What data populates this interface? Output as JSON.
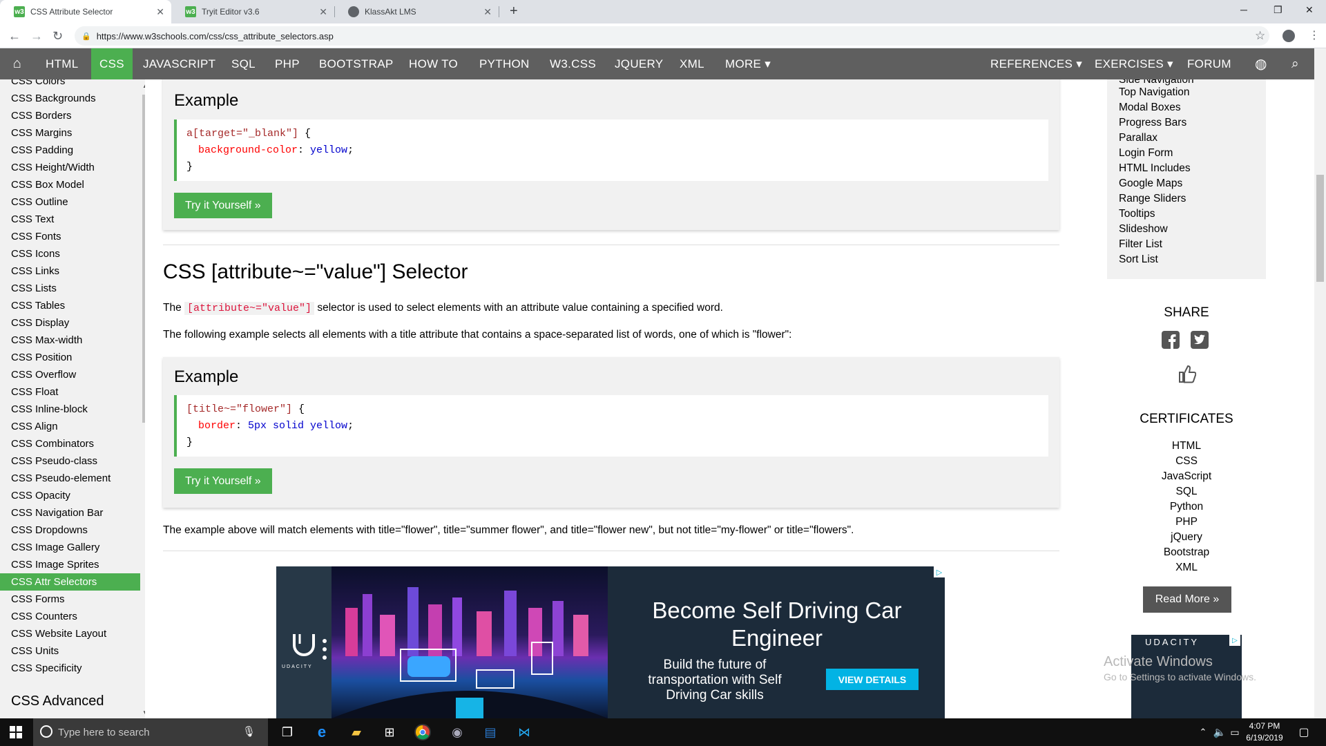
{
  "browser": {
    "tabs": [
      {
        "title": "CSS Attribute Selector",
        "active": true
      },
      {
        "title": "Tryit Editor v3.6",
        "active": false
      },
      {
        "title": "KlassAkt LMS",
        "active": false
      }
    ],
    "url": "https://www.w3schools.com/css/css_attribute_selectors.asp"
  },
  "topnav": {
    "items": [
      "HTML",
      "CSS",
      "JAVASCRIPT",
      "SQL",
      "PHP",
      "BOOTSTRAP",
      "HOW TO",
      "PYTHON",
      "W3.CSS",
      "JQUERY",
      "XML",
      "MORE ▾"
    ],
    "active": "CSS",
    "right_items": [
      "REFERENCES ▾",
      "EXERCISES ▾",
      "FORUM"
    ]
  },
  "sidebar": {
    "items": [
      "CSS Colors",
      "CSS Backgrounds",
      "CSS Borders",
      "CSS Margins",
      "CSS Padding",
      "CSS Height/Width",
      "CSS Box Model",
      "CSS Outline",
      "CSS Text",
      "CSS Fonts",
      "CSS Icons",
      "CSS Links",
      "CSS Lists",
      "CSS Tables",
      "CSS Display",
      "CSS Max-width",
      "CSS Position",
      "CSS Overflow",
      "CSS Float",
      "CSS Inline-block",
      "CSS Align",
      "CSS Combinators",
      "CSS Pseudo-class",
      "CSS Pseudo-element",
      "CSS Opacity",
      "CSS Navigation Bar",
      "CSS Dropdowns",
      "CSS Image Gallery",
      "CSS Image Sprites",
      "CSS Attr Selectors",
      "CSS Forms",
      "CSS Counters",
      "CSS Website Layout",
      "CSS Units",
      "CSS Specificity"
    ],
    "active": "CSS Attr Selectors",
    "advanced_heading": "CSS Advanced"
  },
  "main": {
    "example1": {
      "heading": "Example",
      "code_selector": "a[target=\"_blank\"]",
      "code_open": " {",
      "code_prop": "background-color",
      "code_colon": ": ",
      "code_value": "yellow",
      "code_semi": ";",
      "code_close": "}",
      "button": "Try it Yourself »"
    },
    "section_title": "CSS [attribute~=\"value\"] Selector",
    "para1_before": "The ",
    "para1_code": "[attribute~=\"value\"]",
    "para1_after": " selector is used to select elements with an attribute value containing a specified word.",
    "para2": "The following example selects all elements with a title attribute that contains a space-separated list of words, one of which is \"flower\":",
    "example2": {
      "heading": "Example",
      "code_selector": "[title~=\"flower\"]",
      "code_open": " {",
      "code_prop": "border",
      "code_colon": ": ",
      "code_value": "5px solid yellow",
      "code_semi": ";",
      "code_close": "}",
      "button": "Try it Yourself »"
    },
    "para3": "The example above will match elements with title=\"flower\", title=\"summer flower\", and title=\"flower new\", but not title=\"my-flower\" or title=\"flowers\".",
    "ad": {
      "brand": "UDACITY",
      "headline": "Become Self Driving Car Engineer",
      "subtext": "Build the future of transportation with Self Driving Car skills",
      "button": "VIEW DETAILS"
    }
  },
  "right_sidebar": {
    "howto_items": [
      "Side Navigation",
      "Top Navigation",
      "Modal Boxes",
      "Progress Bars",
      "Parallax",
      "Login Form",
      "HTML Includes",
      "Google Maps",
      "Range Sliders",
      "Tooltips",
      "Slideshow",
      "Filter List",
      "Sort List"
    ],
    "share_heading": "SHARE",
    "certificates_heading": "CERTIFICATES",
    "certificates": [
      "HTML",
      "CSS",
      "JavaScript",
      "SQL",
      "Python",
      "PHP",
      "jQuery",
      "Bootstrap",
      "XML"
    ],
    "read_more": "Read More »",
    "ad_brand": "UDACITY",
    "watermark_title": "Activate Windows",
    "watermark_sub": "Go to Settings to activate Windows."
  },
  "taskbar": {
    "search_placeholder": "Type here to search",
    "time": "4:07 PM",
    "date": "6/19/2019"
  },
  "colors": {
    "w3_green": "#4caf50",
    "nav_gray": "#5f5f5f",
    "udacity_blue": "#02b3e4"
  }
}
